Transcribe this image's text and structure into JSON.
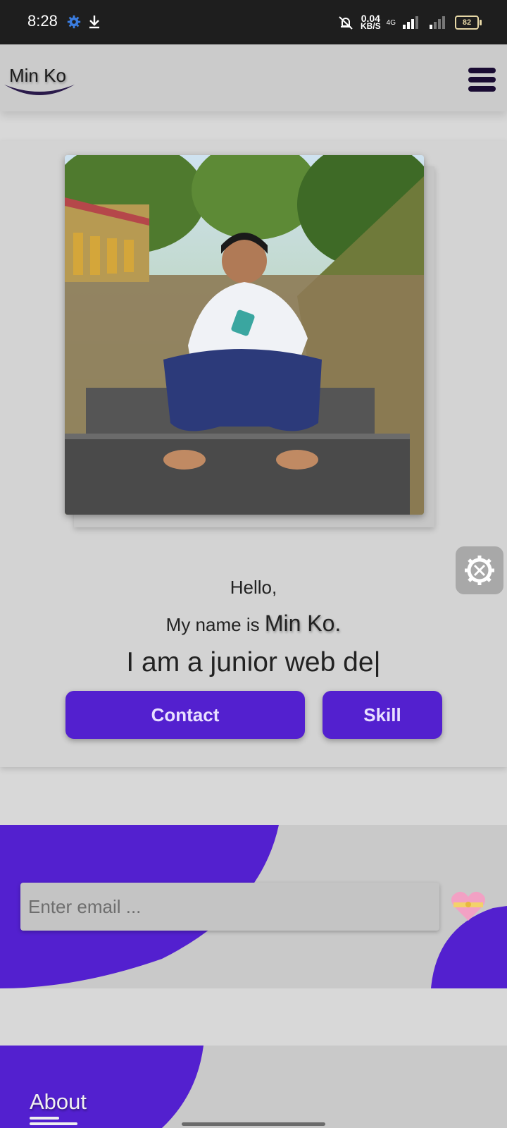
{
  "status_bar": {
    "time": "8:28",
    "net_speed_value": "0.04",
    "net_speed_unit": "KB/S",
    "network_type": "4G",
    "battery": "82"
  },
  "header": {
    "logo_text": "Min Ko",
    "menu_icon": "hamburger-icon"
  },
  "hero": {
    "greeting": "Hello,",
    "intro_prefix": "My name is",
    "intro_name": "Min Ko.",
    "typed_text": "I am a junior web de|",
    "contact_label": "Contact",
    "skill_label": "Skill",
    "settings_icon": "gear-wrench-icon"
  },
  "email": {
    "placeholder": "Enter email ...",
    "value": "",
    "send_icon": "heart-gift-icon"
  },
  "about": {
    "title": "About"
  },
  "colors": {
    "accent": "#5320cf",
    "header_bg": "#cbcbcb",
    "page_bg": "#d8d8d8"
  }
}
